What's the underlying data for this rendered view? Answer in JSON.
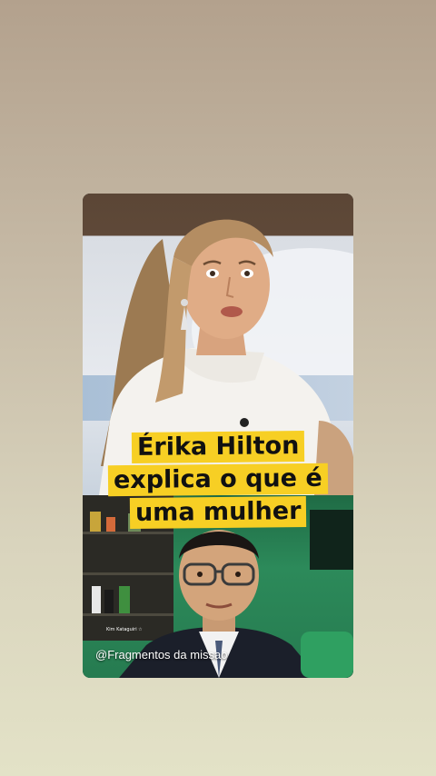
{
  "video": {
    "title_lines": [
      "Érika Hilton",
      "explica o que é",
      "uma mulher"
    ],
    "handle": "@Fragmentos da missao",
    "lower_third": "Kim Kataguiri ☆"
  },
  "colors": {
    "title_highlight": "#f7cf24",
    "title_text": "#111111",
    "background_top": "#b3a18d",
    "background_bottom": "#e3e2c7"
  }
}
